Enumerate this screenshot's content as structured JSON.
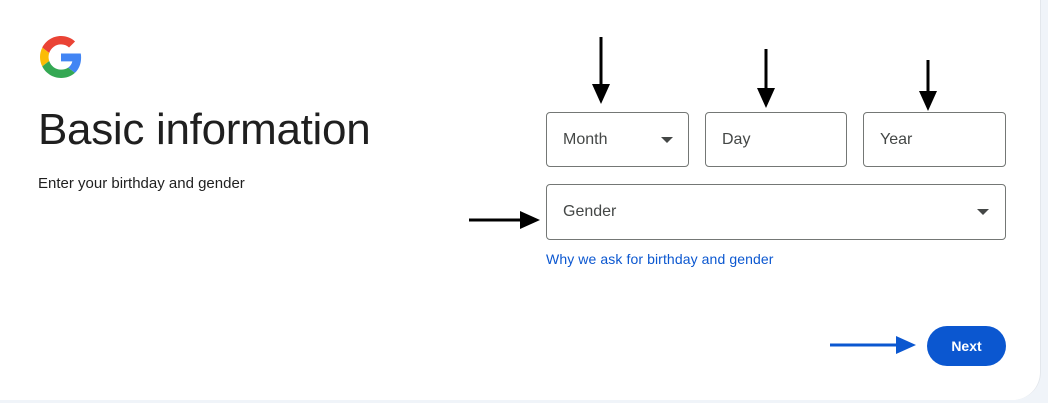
{
  "header": {
    "logo": "google-g-logo",
    "title": "Basic information",
    "subtitle": "Enter your birthday and gender"
  },
  "form": {
    "month": {
      "placeholder": "Month",
      "icon": "dropdown-caret-icon"
    },
    "day": {
      "placeholder": "Day"
    },
    "year": {
      "placeholder": "Year"
    },
    "gender": {
      "placeholder": "Gender",
      "icon": "dropdown-caret-icon"
    },
    "help_link": "Why we ask for birthday and gender"
  },
  "actions": {
    "next_label": "Next"
  },
  "annotations": {
    "arrow_color_black": "#000000",
    "arrow_color_blue": "#0b57d0"
  },
  "colors": {
    "primary": "#0b57d0",
    "border": "#747775",
    "text": "#1f1f1f",
    "muted_text": "#444746"
  }
}
